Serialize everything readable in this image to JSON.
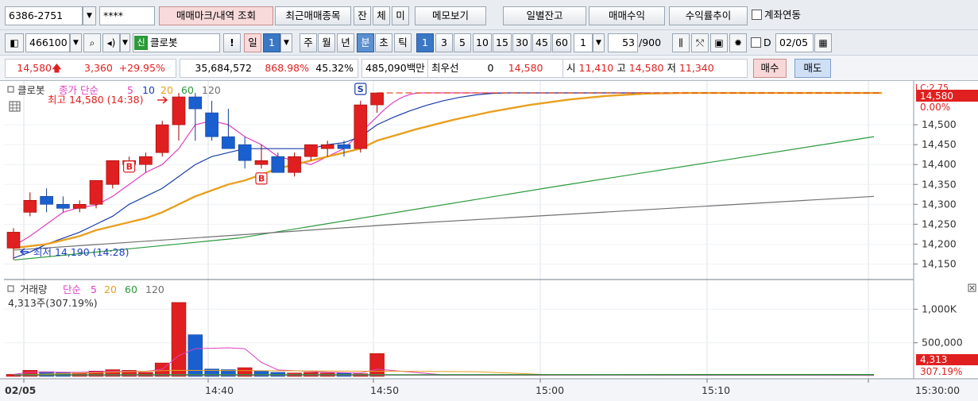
{
  "toolbar": {
    "account_number": "6386-2751",
    "password_mask": "****",
    "trade_mark_button": "매매마크/내역 조회",
    "recent_trades_button": "최근매매종목",
    "filled_button": "잔",
    "contract_button": "체",
    "unfilled_button": "미",
    "memo_button": "메모보기",
    "daily_balance_button": "일별잔고",
    "trade_profit_button": "매매수익",
    "return_trend_button": "수익률추이",
    "account_link_label": "계좌연동"
  },
  "chart_toolbar": {
    "stock_code": "466100",
    "badge": "신",
    "stock_name": "클로봇",
    "exclaim": "!",
    "period_tabs": [
      "일",
      "주",
      "월",
      "년",
      "분",
      "초",
      "틱"
    ],
    "day_value": "1",
    "interval_buttons": [
      "1",
      "3",
      "5",
      "10",
      "15",
      "30",
      "45",
      "60"
    ],
    "count_value": "1",
    "page_count": "53",
    "page_total": "/900",
    "date_checkbox_label": "D",
    "date_value": "02/05"
  },
  "quote": {
    "price": "14,580",
    "change": "3,360",
    "change_rate": "+29.95%",
    "volume": "35,684,572",
    "turnover_ratio": "868.98%",
    "ratio2": "45.32%",
    "trade_value": "485,090백만",
    "best_label": "최우선",
    "best_value": "0",
    "best_price": "14,580",
    "open_label": "시",
    "open": "11,410",
    "high_label": "고",
    "high": "14,580",
    "low_label": "저",
    "low": "11,340",
    "buy_button": "매수",
    "sell_button": "매도"
  },
  "chart": {
    "price_legend": {
      "name": "클로봇",
      "ma_label": "종가 단순",
      "ma_periods": [
        "5",
        "10",
        "20",
        "60",
        "120"
      ],
      "ma_colors": [
        "#e040c0",
        "#1a3ea8",
        "#e8a020",
        "#2a9a3a",
        "#707070"
      ]
    },
    "volume_legend": {
      "name": "거래량",
      "ma_label": "단순",
      "ma_periods": [
        "5",
        "20",
        "60",
        "120"
      ],
      "ma_colors": [
        "#e040c0",
        "#e8a020",
        "#2a9a3a",
        "#707070"
      ],
      "current": "4,313주(307.19%)"
    },
    "high_annotation": "최고 14,580 (14:38)",
    "low_annotation": "최저 14,190 (14:28)",
    "price_tag": "14,580",
    "price_tag_pct": "0.00%",
    "volume_tag": "4,313",
    "volume_tag_pct": "307.19%",
    "corner_tag": "LC:2.75",
    "price_ticks": [
      "14,150",
      "14,200",
      "14,250",
      "14,300",
      "14,350",
      "14,400",
      "14,450",
      "14,500"
    ],
    "volume_ticks": [
      "500,000",
      "1,000K"
    ],
    "time_labels": [
      "02/05",
      "14:40",
      "14:50",
      "15:00",
      "15:10",
      "15:30:00"
    ],
    "marker_buy": "B",
    "marker_sell": "S"
  },
  "chart_data": [
    {
      "type": "candlestick",
      "ylim": [
        14125,
        14600
      ],
      "x": [
        "14:28",
        "14:29",
        "14:30",
        "14:31",
        "14:32",
        "14:33",
        "14:34",
        "14:35",
        "14:36",
        "14:37",
        "14:38",
        "14:39",
        "14:40",
        "14:41",
        "14:42",
        "14:43",
        "14:44",
        "14:45",
        "14:46",
        "14:47",
        "14:48",
        "14:49",
        "14:50"
      ],
      "open": [
        14190,
        14280,
        14320,
        14300,
        14290,
        14300,
        14350,
        14400,
        14400,
        14430,
        14500,
        14570,
        14530,
        14470,
        14450,
        14400,
        14420,
        14380,
        14420,
        14440,
        14450,
        14440,
        14550
      ],
      "high": [
        14240,
        14330,
        14340,
        14320,
        14310,
        14350,
        14410,
        14420,
        14430,
        14510,
        14580,
        14580,
        14560,
        14540,
        14470,
        14450,
        14430,
        14430,
        14450,
        14460,
        14460,
        14560,
        14580
      ],
      "low": [
        14160,
        14270,
        14280,
        14280,
        14280,
        14290,
        14340,
        14380,
        14380,
        14420,
        14460,
        14460,
        14460,
        14450,
        14390,
        14390,
        14380,
        14370,
        14410,
        14420,
        14420,
        14430,
        14530
      ],
      "close": [
        14230,
        14310,
        14300,
        14290,
        14300,
        14360,
        14410,
        14410,
        14420,
        14500,
        14570,
        14540,
        14470,
        14440,
        14410,
        14410,
        14380,
        14420,
        14450,
        14450,
        14440,
        14550,
        14580
      ],
      "ma_lines": [
        {
          "name": "5",
          "values": [
            14195,
            14220,
            14250,
            14280,
            14292,
            14298,
            14320,
            14350,
            14380,
            14400,
            14440,
            14500,
            14510,
            14500,
            14470,
            14450,
            14420,
            14410,
            14400,
            14420,
            14440,
            14480,
            14520
          ]
        },
        {
          "name": "10",
          "values": [
            14165,
            14180,
            14200,
            14215,
            14230,
            14250,
            14270,
            14300,
            14320,
            14340,
            14370,
            14400,
            14420,
            14430,
            14440,
            14440,
            14440,
            14440,
            14440,
            14450,
            14455,
            14470,
            14500
          ]
        },
        {
          "name": "20",
          "values": [
            14190,
            14195,
            14200,
            14210,
            14220,
            14235,
            14245,
            14255,
            14265,
            14280,
            14300,
            14320,
            14335,
            14350,
            14360,
            14375,
            14390,
            14400,
            14410,
            14420,
            14430,
            14440,
            14460
          ]
        }
      ]
    },
    {
      "type": "bar",
      "x": [
        "14:28",
        "14:29",
        "14:30",
        "14:31",
        "14:32",
        "14:33",
        "14:34",
        "14:35",
        "14:36",
        "14:37",
        "14:38",
        "14:39",
        "14:40",
        "14:41",
        "14:42",
        "14:43",
        "14:44",
        "14:45",
        "14:46",
        "14:47",
        "14:48",
        "14:49",
        "14:50"
      ],
      "values": [
        30000,
        90000,
        70000,
        60000,
        50000,
        80000,
        100000,
        90000,
        60000,
        200000,
        1100000,
        620000,
        110000,
        100000,
        130000,
        80000,
        60000,
        50000,
        60000,
        50000,
        50000,
        40000,
        340000
      ],
      "up": [
        true,
        true,
        false,
        false,
        true,
        true,
        true,
        true,
        true,
        true,
        true,
        false,
        false,
        false,
        true,
        false,
        false,
        true,
        true,
        true,
        false,
        true,
        true
      ],
      "ylim": [
        0,
        1300000
      ]
    }
  ]
}
